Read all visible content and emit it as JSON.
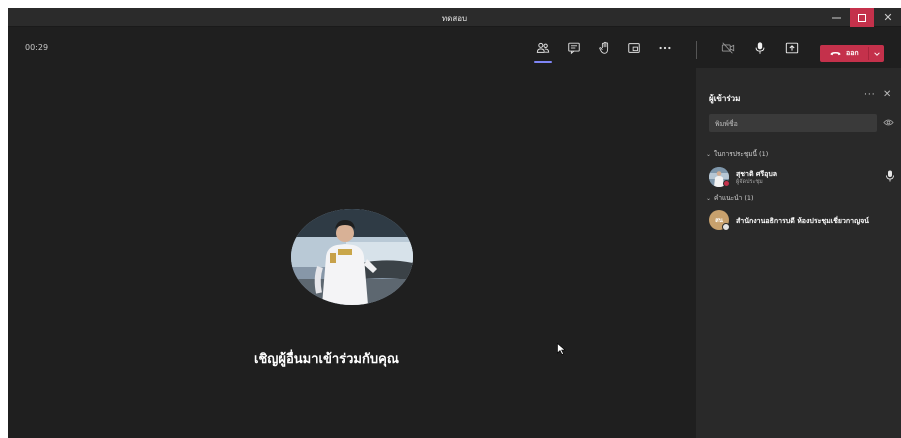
{
  "window": {
    "title": "ทดสอบ"
  },
  "toolbar": {
    "timer": "00:29",
    "leave_label": "ออก",
    "buttons": [
      "participants-icon",
      "chat-icon",
      "raise-hand-icon",
      "rooms-icon",
      "more-icon",
      "camera-off-icon",
      "mic-icon",
      "share-icon"
    ]
  },
  "stage": {
    "invite_text": "เชิญผู้อื่นมาเข้าร่วมกับคุณ"
  },
  "panel": {
    "title": "ผู้เข้าร่วม",
    "more": "···",
    "search_placeholder": "พิมพ์ชื่อ",
    "sections": [
      {
        "label": "ในการประชุมนี้ (1)",
        "participants": [
          {
            "name": "สุชาติ ศรีอุบล",
            "role": "ผู้จัดประชุม"
          }
        ]
      },
      {
        "label": "คำแนะนำ (1)",
        "participants": [
          {
            "initials": "สน",
            "name": "สำนักงานอธิการบดี ห้องประชุมเชี่ยวกาญจน์"
          }
        ]
      }
    ]
  },
  "colors": {
    "accent": "#7f85f5",
    "leave": "#c4314b",
    "background": "#1f1f1f",
    "panel": "#292929"
  }
}
